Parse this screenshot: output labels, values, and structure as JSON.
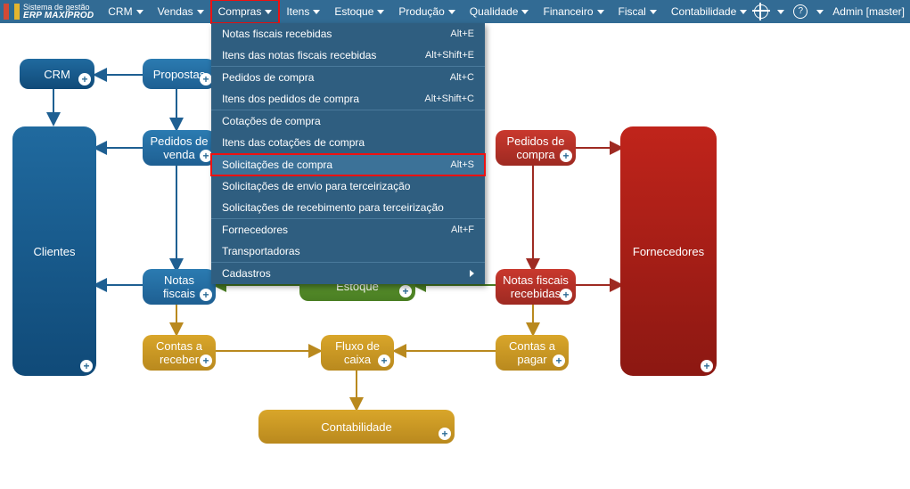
{
  "app": {
    "title_line1": "Sistema de gestão",
    "title_line2": "ERP MAXIPROD"
  },
  "menu": {
    "items": [
      {
        "label": "CRM"
      },
      {
        "label": "Vendas"
      },
      {
        "label": "Compras"
      },
      {
        "label": "Itens"
      },
      {
        "label": "Estoque"
      },
      {
        "label": "Produção"
      },
      {
        "label": "Qualidade"
      },
      {
        "label": "Financeiro"
      },
      {
        "label": "Fiscal"
      },
      {
        "label": "Contabilidade"
      }
    ],
    "active_index": 2,
    "user": "Admin [master]"
  },
  "dropdown": {
    "groups": [
      [
        {
          "label": "Notas fiscais recebidas",
          "shortcut": "Alt+E"
        },
        {
          "label": "Itens das notas fiscais recebidas",
          "shortcut": "Alt+Shift+E"
        }
      ],
      [
        {
          "label": "Pedidos de compra",
          "shortcut": "Alt+C"
        },
        {
          "label": "Itens dos pedidos de compra",
          "shortcut": "Alt+Shift+C"
        }
      ],
      [
        {
          "label": "Cotações de compra",
          "shortcut": ""
        },
        {
          "label": "Itens das cotações de compra",
          "shortcut": ""
        }
      ],
      [
        {
          "label": "Solicitações de compra",
          "shortcut": "Alt+S",
          "highlight": true
        },
        {
          "label": "Solicitações de envio para terceirização",
          "shortcut": ""
        },
        {
          "label": "Solicitações de recebimento para terceirização",
          "shortcut": ""
        }
      ],
      [
        {
          "label": "Fornecedores",
          "shortcut": "Alt+F"
        },
        {
          "label": "Transportadoras",
          "shortcut": ""
        }
      ],
      [
        {
          "label": "Cadastros",
          "submenu": true
        }
      ]
    ]
  },
  "nodes": {
    "crm": "CRM",
    "clientes": "Clientes",
    "propostas": "Propostas",
    "pedidos_venda": "Pedidos de\nvenda",
    "notas_fiscais": "Notas\nfiscais",
    "estoque": "Estoque",
    "pedidos_compra": "Pedidos de\ncompra",
    "notas_fiscais_recebidas": "Notas fiscais\nrecebidas",
    "fornecedores": "Fornecedores",
    "contas_receber": "Contas a\nreceber",
    "fluxo_caixa": "Fluxo de\ncaixa",
    "contas_pagar": "Contas a\npagar",
    "contabilidade": "Contabilidade"
  }
}
